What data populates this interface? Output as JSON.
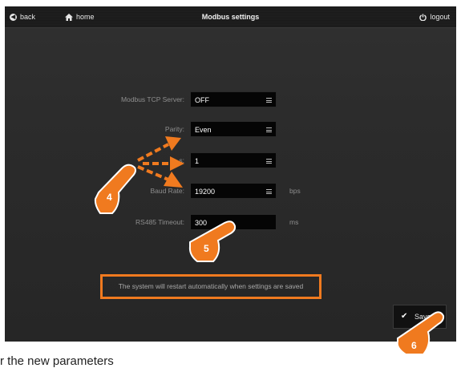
{
  "header": {
    "back_label": "back",
    "home_label": "home",
    "title": "Modbus settings",
    "logout_label": "logout"
  },
  "form": {
    "tcp_server": {
      "label": "Modbus TCP Server:",
      "value": "OFF"
    },
    "parity": {
      "label": "Parity:",
      "value": "Even"
    },
    "stop_bits": {
      "label": "s:",
      "value": "1"
    },
    "baud_rate": {
      "label": "Baud Rate:",
      "value": "19200",
      "unit": "bps"
    },
    "timeout": {
      "label": "RS485 Timeout:",
      "value": "300",
      "unit": "ms"
    }
  },
  "notice": "The system will restart automatically when settings are saved",
  "save_label": "Save",
  "annotations": {
    "step4": "4",
    "step5": "5",
    "step6": "6",
    "accent_color": "#f07a1f"
  },
  "caption": "r the new parameters"
}
